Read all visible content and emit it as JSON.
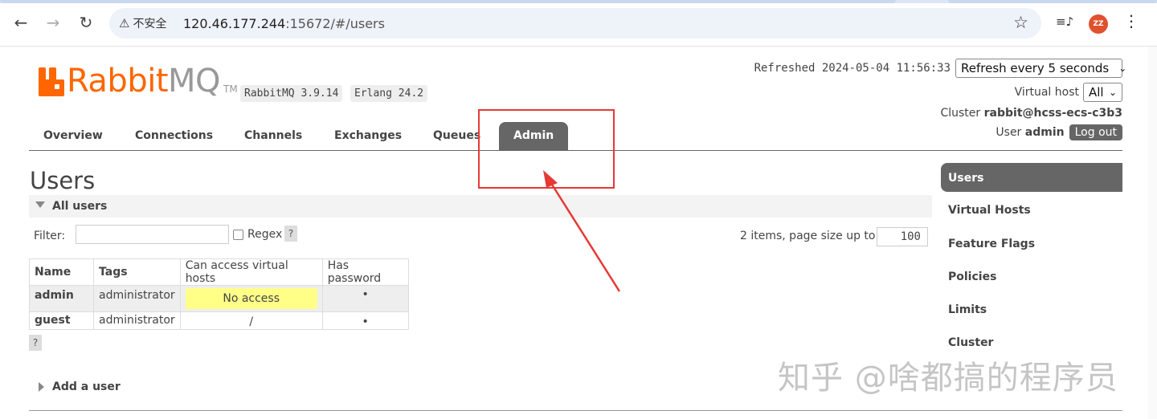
{
  "browser": {
    "security_label": "不安全",
    "url_host": "120.46.177.244",
    "url_rest": ":15672/#/users",
    "avatar_initials": "ZZ"
  },
  "header": {
    "logo_rabbit": "Rabbit",
    "logo_mq": "MQ",
    "logo_tm": "TM",
    "rabbitmq_version": "RabbitMQ 3.9.14",
    "erlang_version": "Erlang 24.2",
    "refreshed_label": "Refreshed 2024-05-04 11:56:33",
    "refresh_select": "Refresh every 5 seconds",
    "vhost_label": "Virtual host",
    "vhost_select": "All",
    "cluster_label": "Cluster",
    "cluster_name": "rabbit@hcss-ecs-c3b3",
    "user_label": "User",
    "user_name": "admin",
    "logout_label": "Log out"
  },
  "tabs": [
    {
      "label": "Overview"
    },
    {
      "label": "Connections"
    },
    {
      "label": "Channels"
    },
    {
      "label": "Exchanges"
    },
    {
      "label": "Queues"
    },
    {
      "label": "Admin",
      "active": true
    }
  ],
  "page": {
    "title": "Users",
    "section_all_users": "All users",
    "filter_label": "Filter:",
    "filter_value": "",
    "regex_label": "Regex",
    "help_glyph": "?",
    "page_info": "2 items, page size up to",
    "page_size": "100",
    "add_user": "Add a user"
  },
  "users_table": {
    "columns": [
      "Name",
      "Tags",
      "Can access virtual hosts",
      "Has password"
    ],
    "rows": [
      {
        "name": "admin",
        "tags": "administrator",
        "vhosts": "No access",
        "has_password": "•"
      },
      {
        "name": "guest",
        "tags": "administrator",
        "vhosts": "/",
        "has_password": "•"
      }
    ]
  },
  "sidebar": {
    "items": [
      {
        "label": "Users",
        "active": true
      },
      {
        "label": "Virtual Hosts"
      },
      {
        "label": "Feature Flags"
      },
      {
        "label": "Policies"
      },
      {
        "label": "Limits"
      },
      {
        "label": "Cluster"
      }
    ]
  },
  "watermark": "知乎 @啥都搞的程序员",
  "colors": {
    "brand_orange": "#ff6600",
    "nav_active": "#666666",
    "annotation_red": "#e53935",
    "no_access_bg": "#ffff88"
  }
}
